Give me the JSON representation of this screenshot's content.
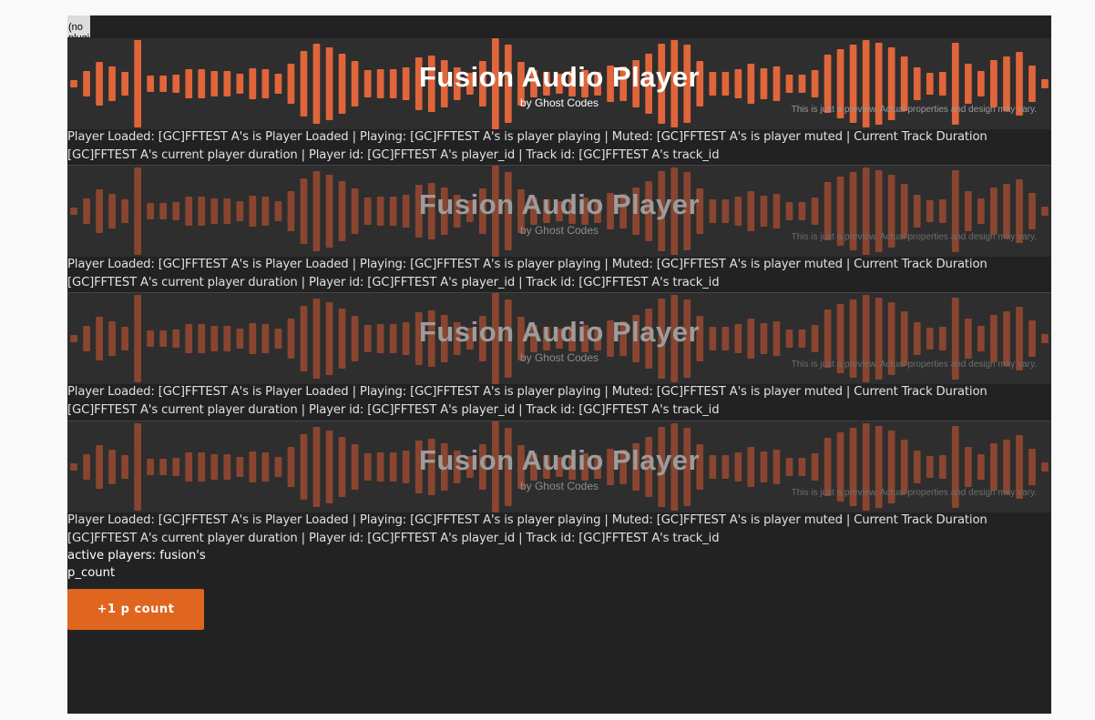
{
  "no_plugin_label": "(no plugin)",
  "colors": {
    "canvas_bg": "#222222",
    "player_bg": "#2e2e2e",
    "wave_bright": "#e0653a",
    "wave_dim": "#8a4530",
    "button_bg": "#e0651f"
  },
  "players": [
    {
      "title": "Fusion Audio Player",
      "subtitle": "by Ghost Codes",
      "preview_note": "This is just a preview. Actual properties and design may vary.",
      "status": "Player Loaded: [GC]FFTEST A's  is Player Loaded | Playing: [GC]FFTEST A's is player playing | Muted: [GC]FFTEST A's is player muted | Current Track Duration [GC]FFTEST A's  current player duration | Player id: [GC]FFTEST A's player_id | Track id: [GC]FFTEST A's track_id"
    },
    {
      "title": "Fusion Audio Player",
      "subtitle": "by Ghost Codes",
      "preview_note": "This is just a preview. Actual properties and design may vary.",
      "status": "Player Loaded: [GC]FFTEST A's  is Player Loaded | Playing: [GC]FFTEST A's is player playing | Muted: [GC]FFTEST A's is player muted | Current Track Duration [GC]FFTEST A's  current player duration | Player id: [GC]FFTEST A's player_id | Track id: [GC]FFTEST A's track_id"
    },
    {
      "title": "Fusion Audio Player",
      "subtitle": "by Ghost Codes",
      "preview_note": "This is just a preview. Actual properties and design may vary.",
      "status": "Player Loaded: [GC]FFTEST A's  is Player Loaded | Playing: [GC]FFTEST A's is player playing | Muted: [GC]FFTEST A's is player muted | Current Track Duration [GC]FFTEST A's  current player duration | Player id: [GC]FFTEST A's player_id | Track id: [GC]FFTEST A's track_id"
    },
    {
      "title": "Fusion Audio Player",
      "subtitle": "by Ghost Codes",
      "preview_note": "This is just a preview. Actual properties and design may vary.",
      "status": "Player Loaded: [GC]FFTEST A's  is Player Loaded | Playing: [GC]FFTEST A's is player playing | Muted: [GC]FFTEST A's is player muted | Current Track Duration [GC]FFTEST A's  current player duration | Player id: [GC]FFTEST A's player_id | Track id: [GC]FFTEST A's track_id"
    }
  ],
  "active_players_label": "active players: fusion's",
  "p_count_label": "p_count",
  "increment_button_label": "+1 p count"
}
